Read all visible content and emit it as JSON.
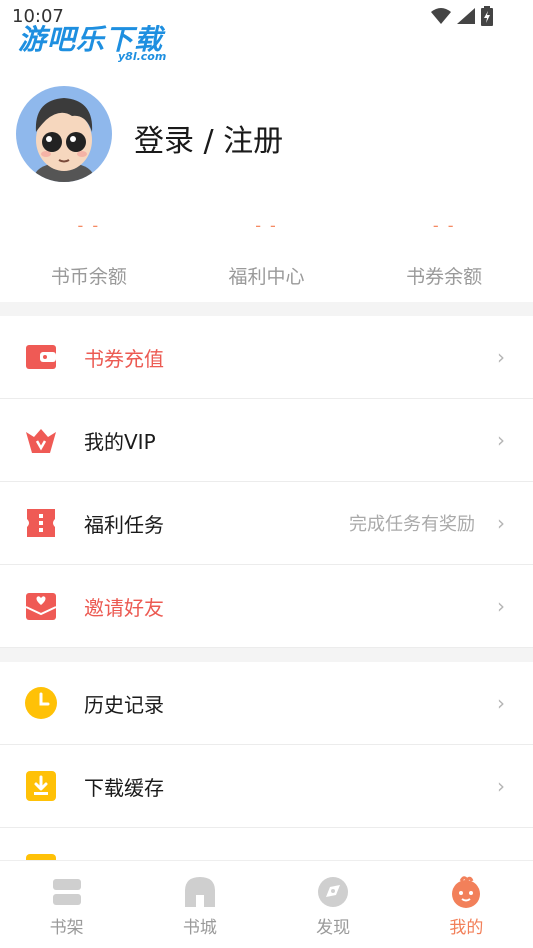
{
  "status_bar": {
    "time": "10:07"
  },
  "watermark": {
    "main": "游吧乐下载",
    "sub": "y8l.com"
  },
  "profile": {
    "login_label": "登录 / 注册"
  },
  "stats": [
    {
      "value": "- -",
      "label": "书币余额"
    },
    {
      "value": "- -",
      "label": "福利中心"
    },
    {
      "value": "- -",
      "label": "书券余额"
    }
  ],
  "menu_group_1": [
    {
      "label": "书券充值",
      "icon": "wallet-icon",
      "hint": ""
    },
    {
      "label": "我的VIP",
      "icon": "crown-icon",
      "hint": ""
    },
    {
      "label": "福利任务",
      "icon": "ticket-icon",
      "hint": "完成任务有奖励"
    },
    {
      "label": "邀请好友",
      "icon": "envelope-heart-icon",
      "hint": ""
    }
  ],
  "menu_group_2": [
    {
      "label": "历史记录",
      "icon": "clock-icon",
      "hint": ""
    },
    {
      "label": "下载缓存",
      "icon": "download-icon",
      "hint": ""
    }
  ],
  "chevron": "›",
  "tabbar": [
    {
      "label": "书架",
      "icon": "bookshelf-icon",
      "active": false
    },
    {
      "label": "书城",
      "icon": "bookstore-icon",
      "active": false
    },
    {
      "label": "发现",
      "icon": "discover-icon",
      "active": false
    },
    {
      "label": "我的",
      "icon": "profile-mascot-icon",
      "active": true
    }
  ],
  "colors": {
    "accent": "#f2805a",
    "red_label": "#ec5a52",
    "icon_red": "#ef5a55",
    "icon_yellow": "#ffc107",
    "divider_bg": "#f4f4f4"
  }
}
